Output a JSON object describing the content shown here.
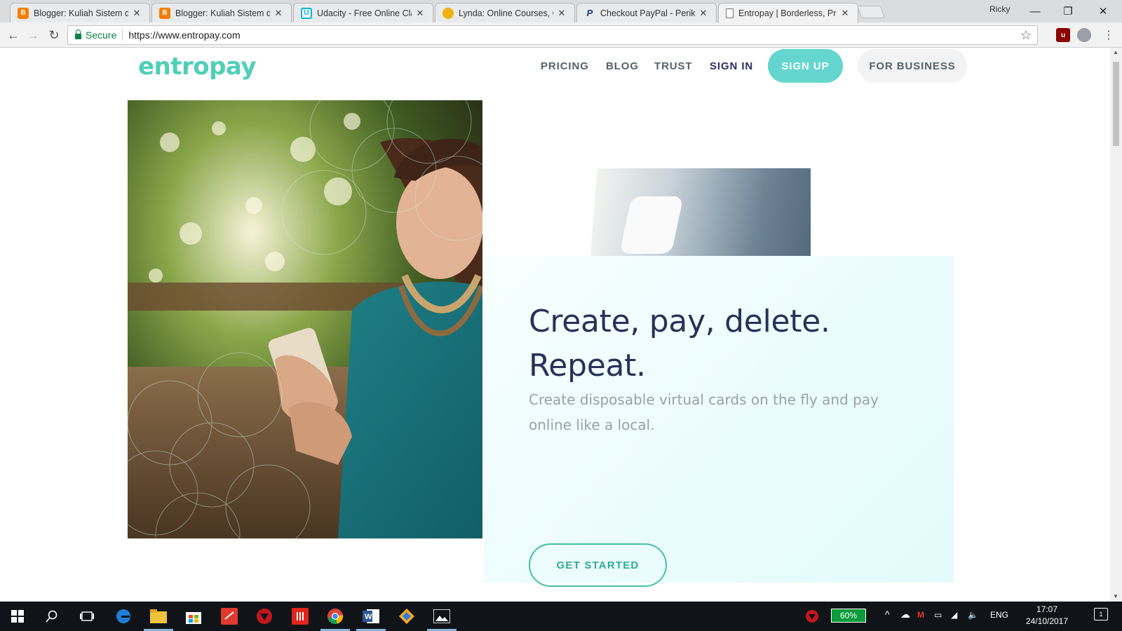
{
  "browser": {
    "tabs": [
      {
        "title": "Blogger: Kuliah Sistem d",
        "icon": "blogger-icon",
        "color": "#f57d00"
      },
      {
        "title": "Blogger: Kuliah Sistem d",
        "icon": "blogger-icon",
        "color": "#f57d00"
      },
      {
        "title": "Udacity - Free Online Cla",
        "icon": "udacity-icon",
        "color": "#02b3e4"
      },
      {
        "title": "Lynda: Online Courses, C",
        "icon": "lynda-icon",
        "color": "#eeb111"
      },
      {
        "title": "Checkout PayPal - Periks",
        "icon": "paypal-icon",
        "color": "#253b80"
      },
      {
        "title": "Entropay | Borderless, Pr",
        "icon": "page-icon",
        "color": "#777777",
        "active": true
      }
    ],
    "profile_name": "Ricky",
    "secure_label": "Secure",
    "url": "https://www.entropay.com"
  },
  "site": {
    "logo": "entropay",
    "nav": {
      "pricing": "PRICING",
      "blog": "BLOG",
      "trust": "TRUST",
      "signin": "SIGN IN",
      "signup": "SIGN UP",
      "business": "FOR BUSINESS"
    },
    "hero": {
      "headline_line1": "Create, pay, delete.",
      "headline_line2": "Repeat.",
      "subline": "Create disposable virtual cards on the fly and pay online like a local.",
      "cta": "GET STARTED"
    },
    "colors": {
      "brand": "#4fcfb8",
      "signup_bg": "#64d6cf",
      "headline": "#28325a"
    }
  },
  "taskbar": {
    "battery": "60%",
    "language": "ENG",
    "time": "17:07",
    "date": "24/10/2017",
    "notification_count": "1"
  }
}
